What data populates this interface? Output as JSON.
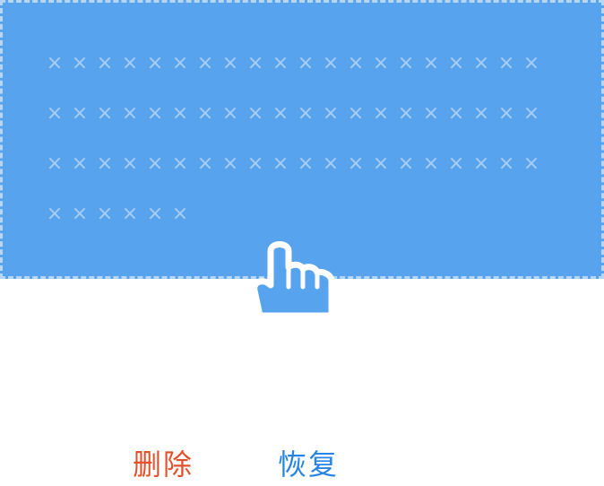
{
  "editor": {
    "masked_lines": [
      "××××××××××××××××××××",
      "××××××××××××××××××××",
      "××××××××××××××××××××",
      "××××××"
    ]
  },
  "actions": {
    "delete_label": "删除",
    "restore_label": "恢复"
  },
  "colors": {
    "selection": "#58a3ee",
    "selection_border": "#b7d6f6",
    "mask_mark": "#a9cdf4",
    "delete": "#e2502c",
    "restore": "#2685e4"
  },
  "icons": {
    "pointer": "hand-pointer-icon"
  }
}
